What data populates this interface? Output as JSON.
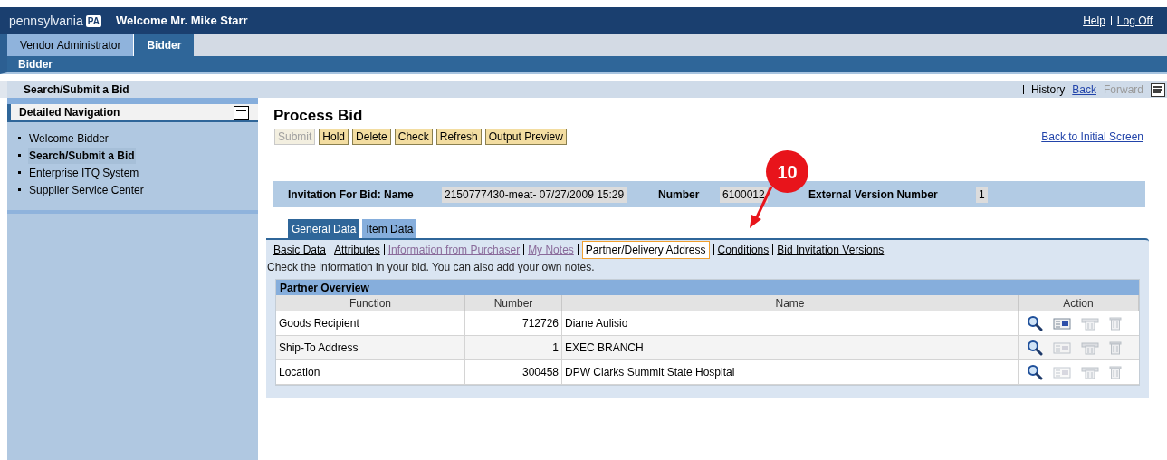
{
  "header": {
    "logo": "pennsylvania",
    "logo_badge": "PA",
    "welcome": "Welcome Mr. Mike Starr",
    "links": [
      "Help",
      "Log Off"
    ]
  },
  "top_tabs": [
    {
      "label": "Vendor Administrator",
      "selected": false
    },
    {
      "label": "Bidder",
      "selected": true
    }
  ],
  "sub_bar": {
    "label": "Bidder"
  },
  "page_bar": {
    "title": "Search/Submit a Bid",
    "history": "History",
    "back": "Back",
    "forward": "Forward"
  },
  "sidebar": {
    "title": "Detailed Navigation",
    "items": [
      {
        "label": "Welcome Bidder",
        "selected": false
      },
      {
        "label": "Search/Submit a Bid",
        "selected": true
      },
      {
        "label": "Enterprise ITQ System",
        "selected": false
      },
      {
        "label": "Supplier Service Center",
        "selected": false
      }
    ]
  },
  "main": {
    "title": "Process Bid",
    "buttons": [
      {
        "label": "Submit",
        "disabled": true
      },
      {
        "label": "Hold",
        "disabled": false
      },
      {
        "label": "Delete",
        "disabled": false
      },
      {
        "label": "Check",
        "disabled": false
      },
      {
        "label": "Refresh",
        "disabled": false
      },
      {
        "label": "Output Preview",
        "disabled": false
      }
    ],
    "back_link": "Back to Initial Screen",
    "info": [
      {
        "label": "Invitation For Bid: Name",
        "value": "2150777430-meat- 07/27/2009 15:29"
      },
      {
        "label": "Number",
        "value": "6100012"
      },
      {
        "label": "External Version Number",
        "value": "1"
      }
    ],
    "tabs": [
      {
        "label": "General Data",
        "selected": true
      },
      {
        "label": "Item Data",
        "selected": false
      }
    ],
    "sublinks": [
      {
        "label": "Basic Data",
        "visited": false,
        "selected": false
      },
      {
        "label": "Attributes",
        "visited": false,
        "selected": false
      },
      {
        "label": "Information from Purchaser",
        "visited": true,
        "selected": false
      },
      {
        "label": "My Notes",
        "visited": true,
        "selected": false
      },
      {
        "label": "Partner/Delivery Address",
        "visited": false,
        "selected": true
      },
      {
        "label": "Conditions",
        "visited": false,
        "selected": false
      },
      {
        "label": "Bid Invitation Versions",
        "visited": false,
        "selected": false
      }
    ],
    "hint": "Check the information in your bid. You can also add your own notes.",
    "table": {
      "title": "Partner Overview",
      "columns": [
        "Function",
        "Number",
        "Name",
        "Action"
      ],
      "rows": [
        {
          "function": "Goods Recipient",
          "number": "712726",
          "name": "Diane Aulisio",
          "mail_disabled": false
        },
        {
          "function": "Ship-To Address",
          "number": "1",
          "name": "EXEC BRANCH",
          "mail_disabled": true
        },
        {
          "function": "Location",
          "number": "300458",
          "name": "DPW Clarks Summit State Hospital",
          "mail_disabled": true
        }
      ]
    }
  },
  "callout": {
    "label": "10"
  }
}
